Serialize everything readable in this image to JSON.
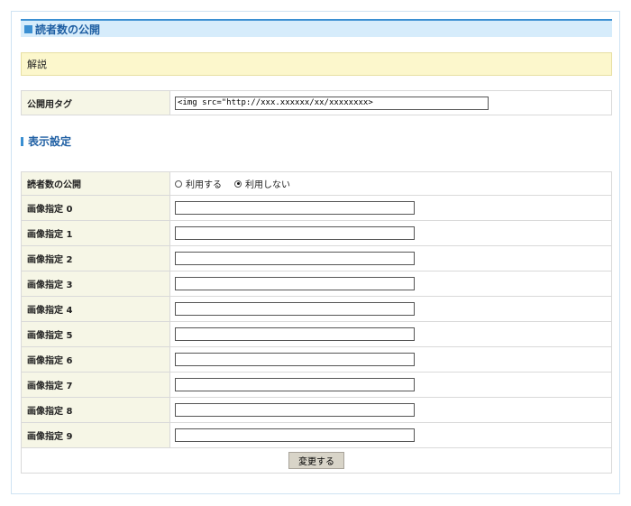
{
  "header": {
    "title": "読者数の公開"
  },
  "notice": {
    "text": "解説"
  },
  "tag": {
    "label": "公開用タグ",
    "value": "<img src=\"http://xxx.xxxxxx/xx/xxxxxxxx>"
  },
  "section": {
    "title": "表示設定"
  },
  "settings": {
    "publish_label": "読者数の公開",
    "options": [
      {
        "label": "利用する",
        "checked": false
      },
      {
        "label": "利用しない",
        "checked": true
      }
    ],
    "images": [
      {
        "label": "画像指定 0",
        "value": ""
      },
      {
        "label": "画像指定 1",
        "value": ""
      },
      {
        "label": "画像指定 2",
        "value": ""
      },
      {
        "label": "画像指定 3",
        "value": ""
      },
      {
        "label": "画像指定 4",
        "value": ""
      },
      {
        "label": "画像指定 5",
        "value": ""
      },
      {
        "label": "画像指定 6",
        "value": ""
      },
      {
        "label": "画像指定 7",
        "value": ""
      },
      {
        "label": "画像指定 8",
        "value": ""
      },
      {
        "label": "画像指定 9",
        "value": ""
      }
    ],
    "submit_label": "変更する"
  },
  "colors": {
    "accent": "#3a8fd2",
    "header_bg": "#d6ecfb",
    "notice_bg": "#fcf7cc",
    "label_bg": "#f6f6e6"
  }
}
